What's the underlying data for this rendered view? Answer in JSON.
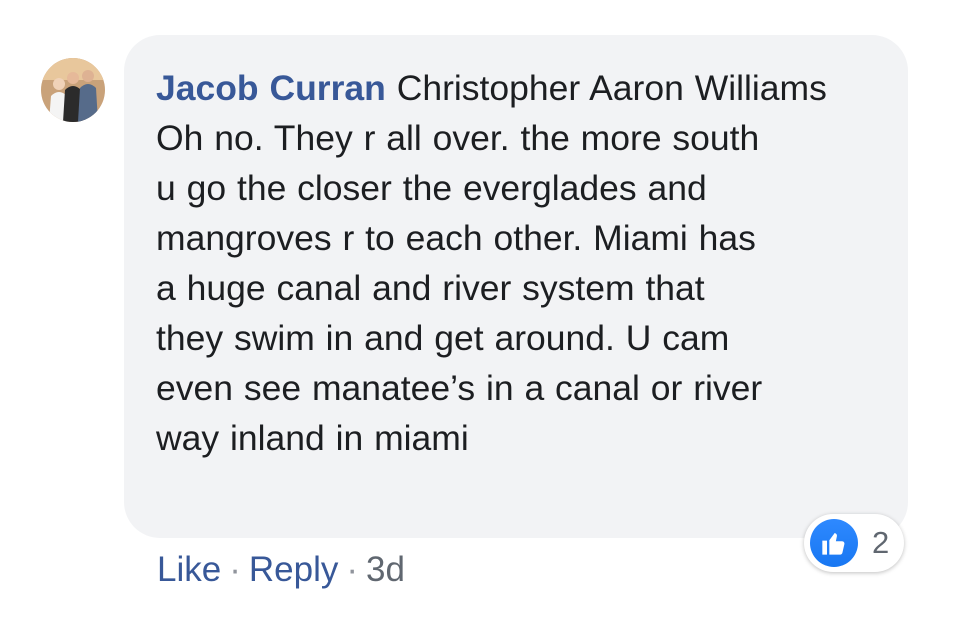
{
  "comment": {
    "author": "Jacob Curran",
    "mention": "Christopher Aaron Williams",
    "body_lines": [
      "Oh no. They r all over. the more south",
      "u go the closer the everglades and",
      "mangroves r to each other. Miami has",
      "a huge canal and river system that",
      "they swim in and get around. U cam",
      "even see manatee’s in a canal or river",
      "way inland in miami"
    ],
    "reactions": {
      "icon": "thumbs-up-icon",
      "count": "2",
      "color": "#1877f2"
    },
    "actions": {
      "like_label": "Like",
      "separator": "·",
      "reply_label": "Reply",
      "timestamp": "3d"
    }
  },
  "colors": {
    "author_link": "#385898",
    "bubble_bg": "#f2f3f5",
    "text": "#1c1e21",
    "meta_text": "#606770"
  }
}
